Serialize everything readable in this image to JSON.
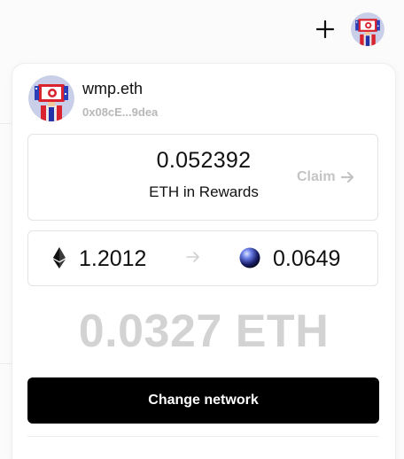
{
  "header": {
    "add_icon": "plus-icon",
    "avatar_icon": "nft-avatar"
  },
  "account": {
    "name": "wmp.eth",
    "address": "0x08cE...9dea",
    "avatar_icon": "nft-avatar"
  },
  "rewards": {
    "amount": "0.052392",
    "label": "ETH in Rewards",
    "claim_label": "Claim",
    "claim_icon": "arrow-right-icon"
  },
  "balances": {
    "eth_icon": "ethereum-icon",
    "eth_amount": "1.2012",
    "arrow_icon": "arrow-right-icon",
    "token_icon": "blue-orb-icon",
    "token_amount": "0.0649"
  },
  "total_value": "0.0327 ETH",
  "actions": {
    "change_network_label": "Change network"
  },
  "colors": {
    "primary_button": "#000000",
    "muted_text": "#b8b8b8",
    "big_value": "#d3d3d3",
    "border": "#e4e4e4"
  }
}
